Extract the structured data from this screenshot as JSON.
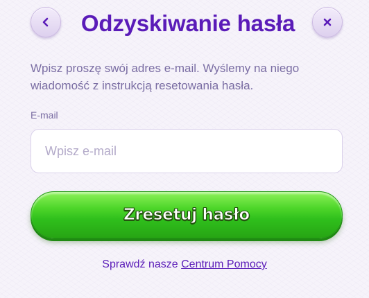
{
  "header": {
    "back_icon": "chevron-left-icon",
    "title": "Odzyskiwanie hasła",
    "close_icon": "close-icon"
  },
  "description": "Wpisz proszę swój adres e-mail. Wyślemy na niego wiadomość z instrukcją resetowania hasła.",
  "form": {
    "email_label": "E-mail",
    "email_placeholder": "Wpisz e-mail",
    "email_value": "",
    "submit_label": "Zresetuj hasło"
  },
  "help": {
    "prefix": "Sprawdź nasze",
    "link_label": "Centrum Pomocy"
  },
  "colors": {
    "accent_purple": "#5a1bb8",
    "text_muted": "#7a6da3",
    "button_green": "#3ccb22"
  }
}
